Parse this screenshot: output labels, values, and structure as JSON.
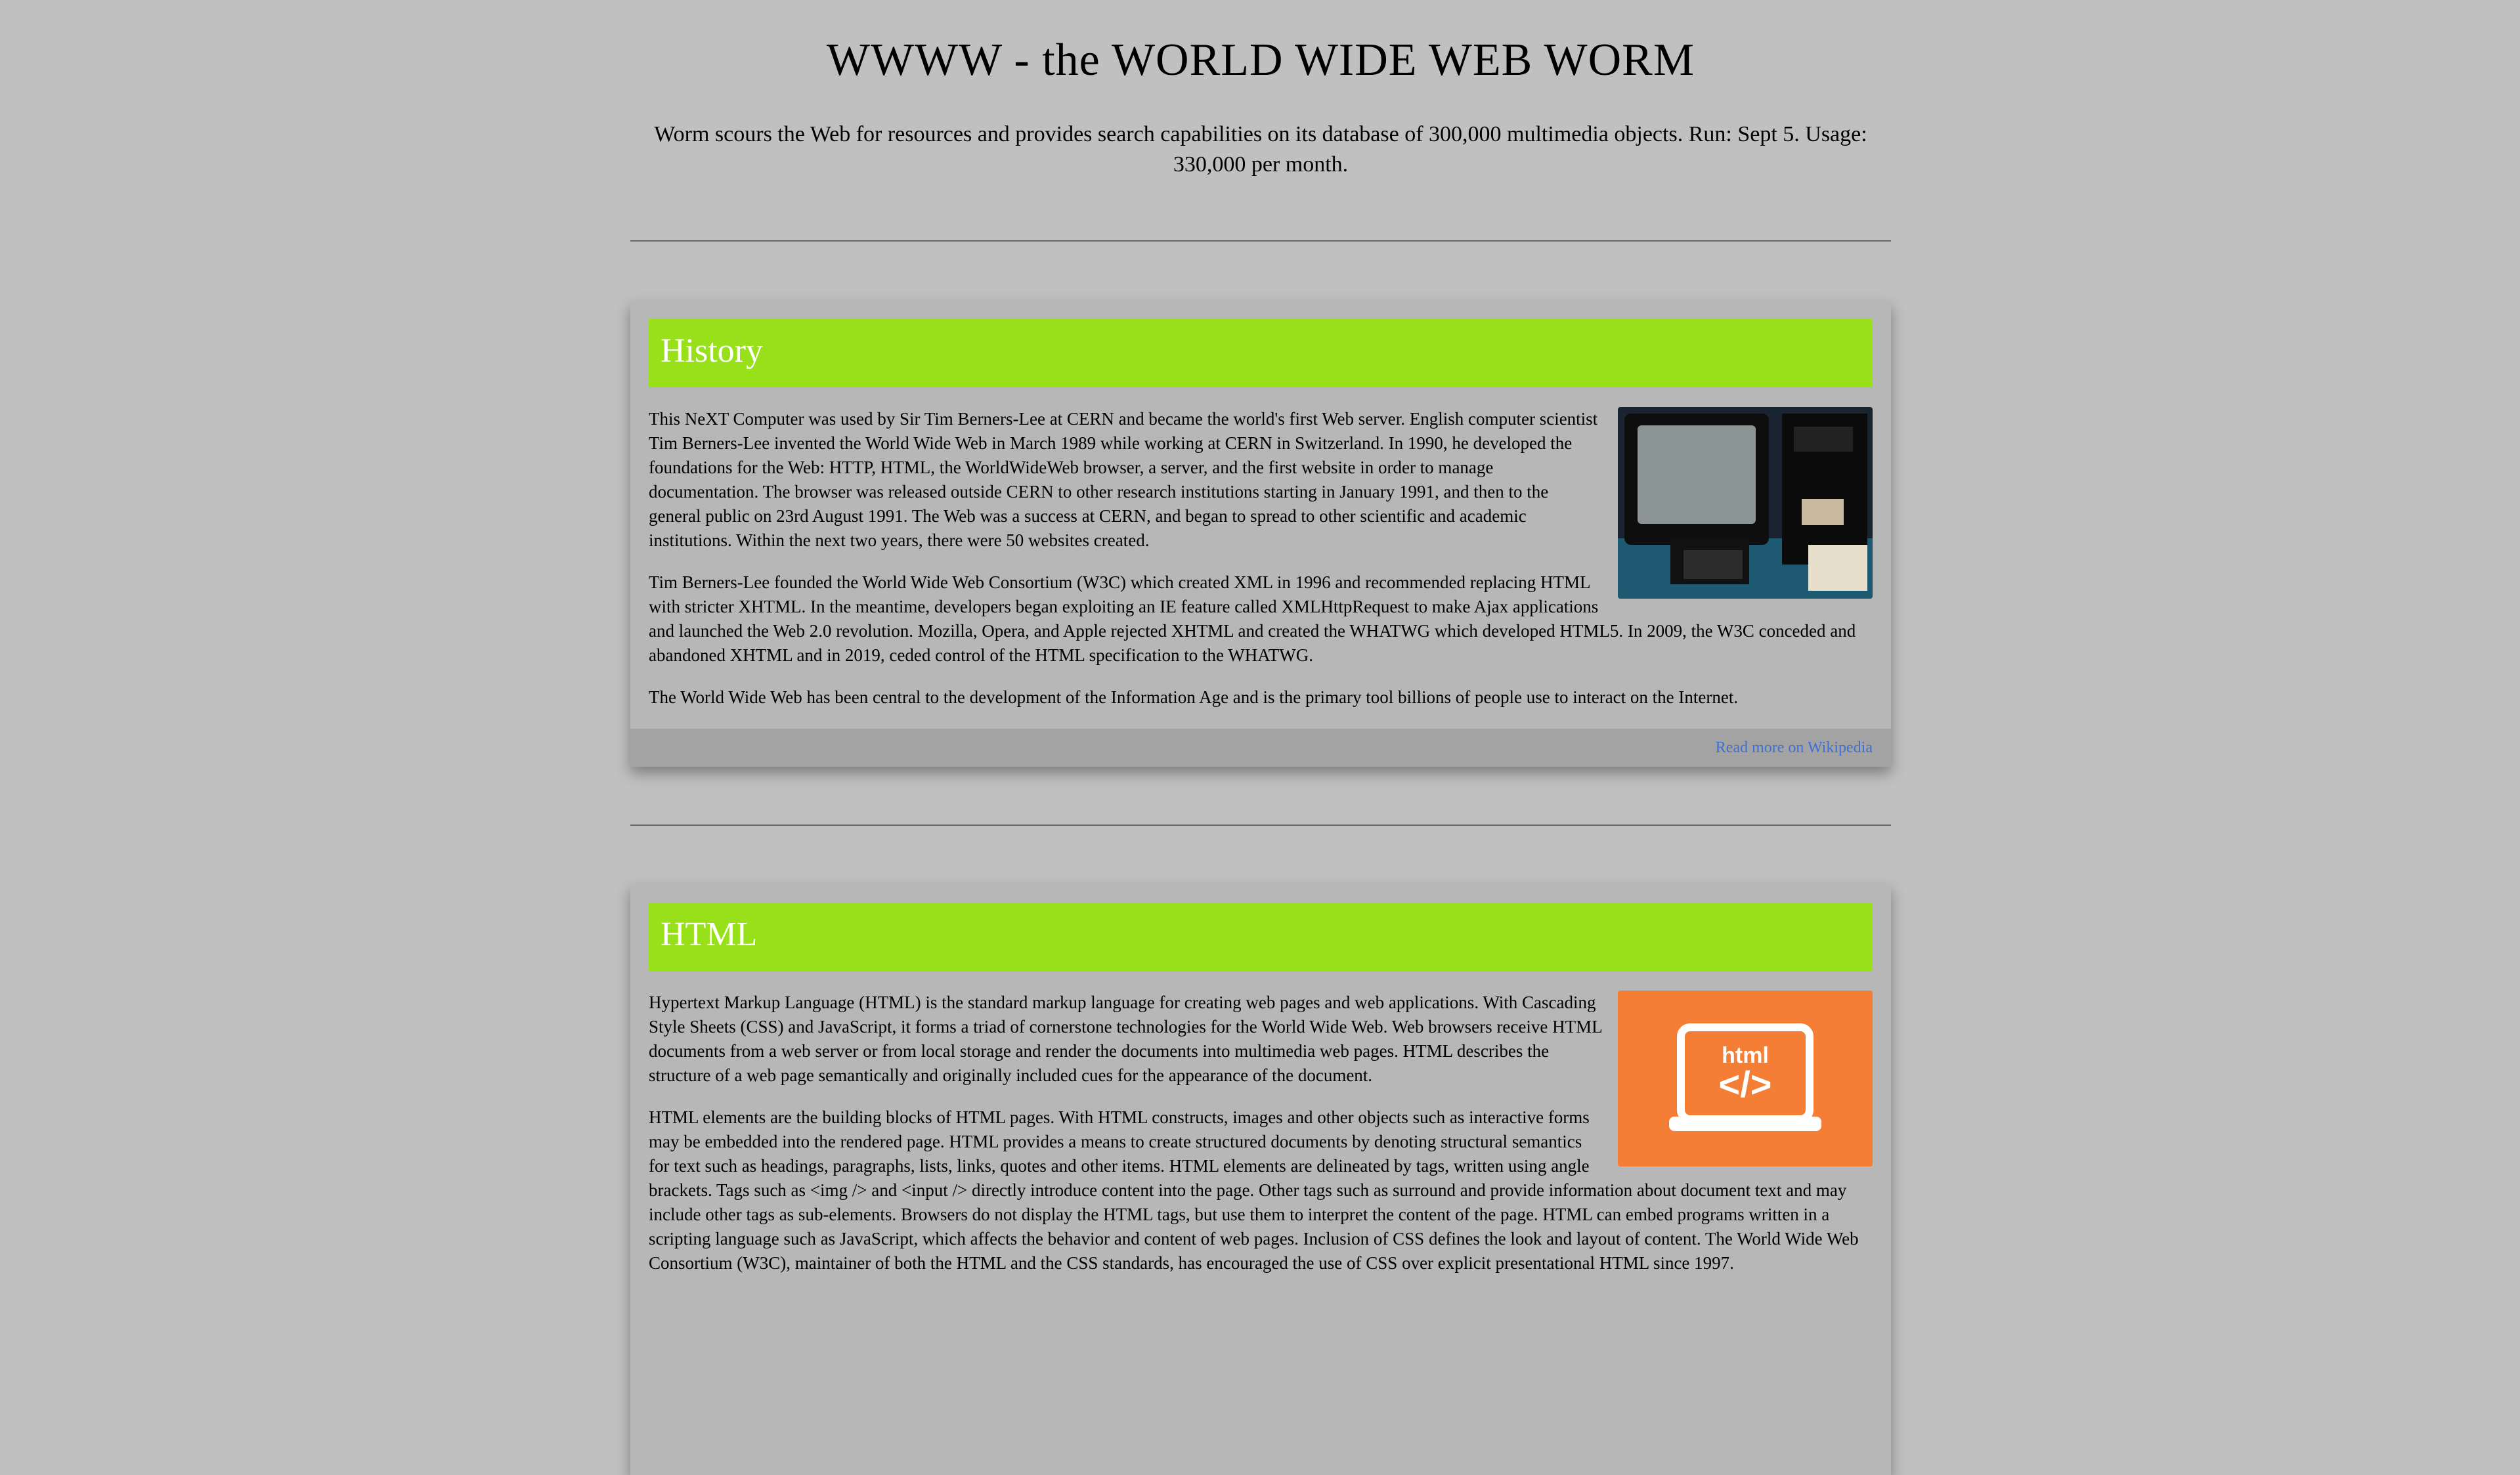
{
  "header": {
    "title": "WWWW - the WORLD WIDE WEB WORM",
    "intro": "Worm scours the Web for resources and provides search capabilities on its database of 300,000 multimedia objects. Run: Sept 5. Usage: 330,000 per month."
  },
  "sections": [
    {
      "heading": "History",
      "image_label": "NeXT Computer",
      "paragraphs": [
        "This NeXT Computer was used by Sir Tim Berners-Lee at CERN and became the world's first Web server. English computer scientist Tim Berners-Lee invented the World Wide Web in March 1989 while working at CERN in Switzerland. In 1990, he developed the foundations for the Web: HTTP, HTML, the WorldWideWeb browser, a server, and the first website in order to manage documentation. The browser was released outside CERN to other research institutions starting in January 1991, and then to the general public on 23rd August 1991. The Web was a success at CERN, and began to spread to other scientific and academic institutions. Within the next two years, there were 50 websites created.",
        "Tim Berners-Lee founded the World Wide Web Consortium (W3C) which created XML in 1996 and recommended replacing HTML with stricter XHTML. In the meantime, developers began exploiting an IE feature called XMLHttpRequest to make Ajax applications and launched the Web 2.0 revolution. Mozilla, Opera, and Apple rejected XHTML and created the WHATWG which developed HTML5. In 2009, the W3C conceded and abandoned XHTML and in 2019, ceded control of the HTML specification to the WHATWG.",
        "The World Wide Web has been central to the development of the Information Age and is the primary tool billions of people use to interact on the Internet."
      ],
      "link": "Read more on Wikipedia"
    },
    {
      "heading": "HTML",
      "image_label": "html",
      "image_code": "</>",
      "paragraphs": [
        "Hypertext Markup Language (HTML) is the standard markup language for creating web pages and web applications. With Cascading Style Sheets (CSS) and JavaScript, it forms a triad of cornerstone technologies for the World Wide Web. Web browsers receive HTML documents from a web server or from local storage and render the documents into multimedia web pages. HTML describes the structure of a web page semantically and originally included cues for the appearance of the document.",
        "HTML elements are the building blocks of HTML pages. With HTML constructs, images and other objects such as interactive forms may be embedded into the rendered page. HTML provides a means to create structured documents by denoting structural semantics for text such as headings, paragraphs, lists, links, quotes and other items. HTML elements are delineated by tags, written using angle brackets. Tags such as <img /> and <input /> directly introduce content into the page. Other tags such as surround and provide information about document text and may include other tags as sub-elements. Browsers do not display the HTML tags, but use them to interpret the content of the page. HTML can embed programs written in a scripting language such as JavaScript, which affects the behavior and content of web pages. Inclusion of CSS defines the look and layout of content. The World Wide Web Consortium (W3C), maintainer of both the HTML and the CSS standards, has encouraged the use of CSS over explicit presentational HTML since 1997."
      ]
    }
  ],
  "colors": {
    "background": "#c0c0c0",
    "card": "#b7b7b7",
    "header_bar": "#97e01a",
    "footer": "#a3a3a3",
    "link": "#3d6fd6",
    "html_logo": "#f47e35"
  },
  "icons": {
    "history_image": "computer-photo",
    "html_image": "html-laptop-icon"
  }
}
